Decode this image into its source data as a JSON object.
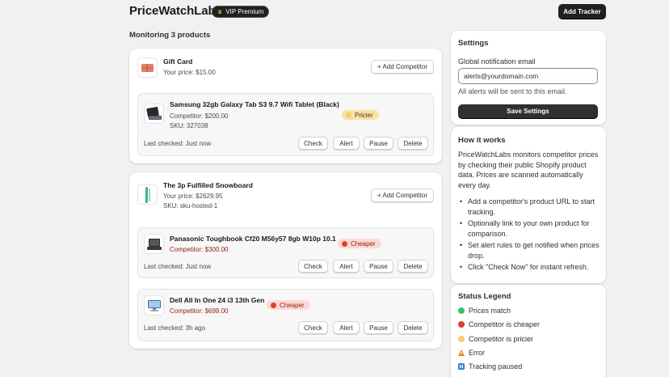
{
  "header": {
    "app_title": "PriceWatchLabs",
    "vip_label": "VIP Premium",
    "add_tracker_label": "Add Tracker"
  },
  "monitoring_label": "Monitoring 3 products",
  "products": [
    {
      "name": "Gift Card",
      "your_price": "Your price: $15.00",
      "add_competitor_label": "+ Add Competitor",
      "competitors": [
        {
          "name": "Samsung 32gb Galaxy Tab S3 9.7 Wifi Tablet (Black)",
          "price": "Competitor: $200.00",
          "sku": "SKU: 327038",
          "status": "Pricier",
          "last_checked": "Last checked: Just now",
          "buttons": [
            "Check",
            "Alert",
            "Pause",
            "Delete"
          ]
        }
      ]
    },
    {
      "name": "The 3p Fulfilled Snowboard",
      "your_price": "Your price: $2629.95",
      "sku": "SKU: sku-hosted-1",
      "add_competitor_label": "+ Add Competitor",
      "competitors": [
        {
          "name": "Panasonic Toughbook Cf20 M56y57 8gb W10p 10.1",
          "price": "Competitor: $300.00",
          "status": "Cheaper",
          "last_checked": "Last checked: Just now",
          "buttons": [
            "Check",
            "Alert",
            "Pause",
            "Delete"
          ]
        },
        {
          "name": "Dell All In One 24 i3 13th Gen",
          "price": "Competitor: $699.00",
          "status": "Cheaper",
          "last_checked": "Last checked: 3h ago",
          "buttons": [
            "Check",
            "Alert",
            "Pause",
            "Delete"
          ]
        }
      ]
    }
  ],
  "settings": {
    "title": "Settings",
    "email_label": "Global notification email",
    "email_value": "alerts@yourdomain.com",
    "helper_text": "All alerts will be sent to this email.",
    "save_label": "Save Settings"
  },
  "how_it_works": {
    "title": "How it works",
    "intro": "PriceWatchLabs monitors competitor prices by checking their public Shopify product data. Prices are scanned automatically every day.",
    "steps": [
      "Add a competitor's product URL to start tracking.",
      "Optionally link to your own product for comparison.",
      "Set alert rules to get notified when prices drop.",
      "Click \"Check Now\" for instant refresh."
    ]
  },
  "legend": {
    "title": "Status Legend",
    "items": [
      {
        "label": "Prices match",
        "icon": "green-circle-icon",
        "color": "#34c46a"
      },
      {
        "label": "Competitor is cheaper",
        "icon": "red-circle-icon",
        "color": "#e0412c"
      },
      {
        "label": "Competitor is pricier",
        "icon": "yellow-circle-icon",
        "color": "#f6cf6a"
      },
      {
        "label": "Error",
        "icon": "warning-icon",
        "color": "#e08a1e"
      },
      {
        "label": "Tracking paused",
        "icon": "pause-icon",
        "color": "#3b7dd8"
      }
    ]
  },
  "colors": {
    "cheaper_bg": "#fdd9d4",
    "cheaper_dot": "#e0412c",
    "pricier_bg": "#fbe0a6",
    "pricier_dot": "#f6cf6a",
    "primary_button": "#303030"
  }
}
